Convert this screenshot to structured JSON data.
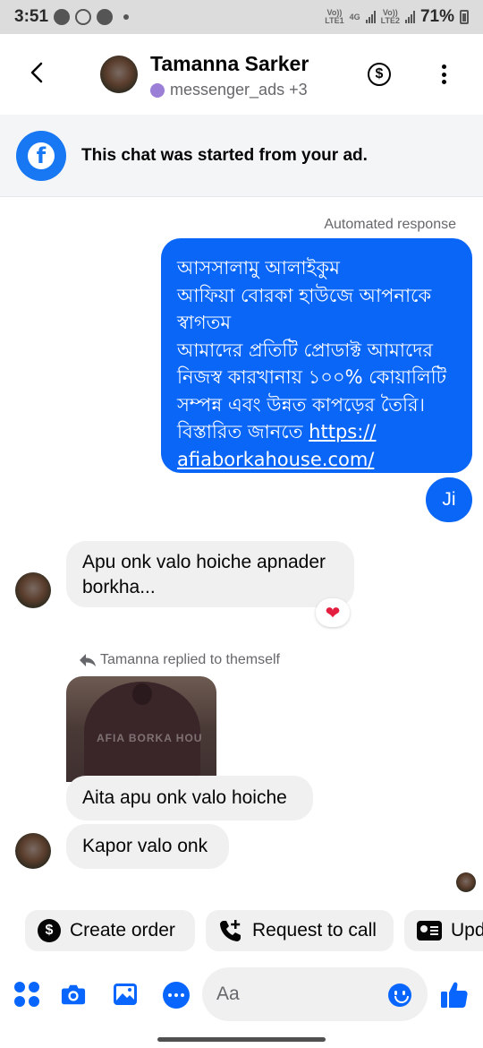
{
  "status_bar": {
    "time": "3:51",
    "volte1": "Vo))\nLTE1",
    "net": "4G",
    "volte2": "Vo))\nLTE2",
    "battery": "71%"
  },
  "header": {
    "contact_name": "Tamanna Sarker",
    "subtitle": "messenger_ads +3",
    "icons": [
      "back-arrow-icon",
      "dollar-icon",
      "more-vertical-icon"
    ]
  },
  "ad_banner": {
    "text": "This chat was started from your ad.",
    "icon": "facebook-icon"
  },
  "messages": {
    "automated_label": "Automated response",
    "outgoing_lines": [
      "আসসালামু আলাইকুম",
      "আফিয়া বোরকা হাউজে আপনাকে",
      "স্বাগতম",
      "আমাদের প্রতিটি প্রোডাক্ট আমাদের",
      "নিজস্ব কারখানায় ১০০% কোয়ালিটি",
      "সম্পন্ন এবং উন্নত কাপড়ের তৈরি।",
      "বিস্তারিত জানতে "
    ],
    "outgoing_link_part1": "https://",
    "outgoing_link_part2": "afiaborkahouse.com/",
    "ji": "Ji",
    "incoming_1": "Apu onk valo hoiche apnader borkha...",
    "reaction": "❤",
    "reply_note": "Tamanna replied to themself",
    "reply_image_watermark": "AFIA BORKA HOU",
    "incoming_2": "Aita apu onk valo hoiche",
    "incoming_3": "Kapor valo onk"
  },
  "quick_actions": {
    "create_order": "Create order",
    "request_call": "Request to call",
    "update": "Upd"
  },
  "composer": {
    "placeholder": "Aa"
  },
  "colors": {
    "brand_blue": "#0866ff",
    "bubble_out": "#0a66f7",
    "bubble_in": "#f0f0f0",
    "status_bar": "#dcdcdc"
  }
}
